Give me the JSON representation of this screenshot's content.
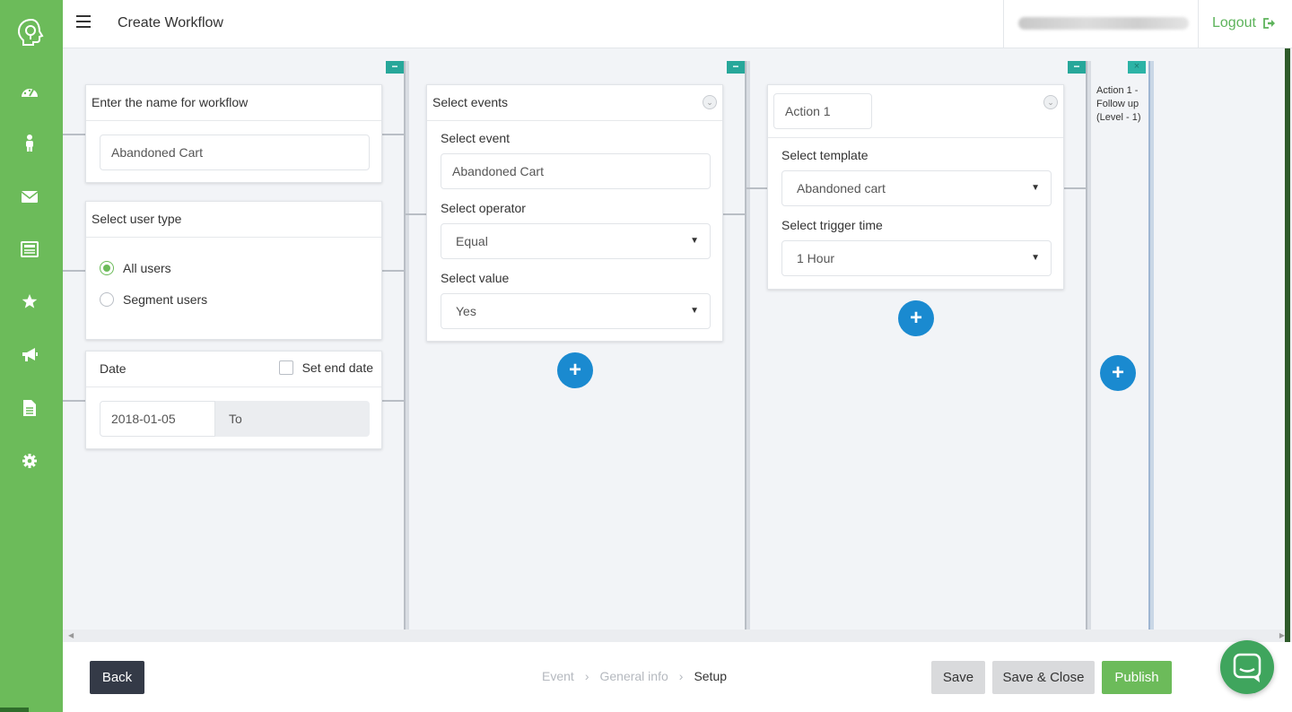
{
  "header": {
    "title": "Create Workflow",
    "logout_label": "Logout"
  },
  "sidebar": {
    "items": [
      {
        "icon": "dashboard-icon"
      },
      {
        "icon": "user-icon"
      },
      {
        "icon": "envelope-icon"
      },
      {
        "icon": "list-icon"
      },
      {
        "icon": "star-icon"
      },
      {
        "icon": "megaphone-icon"
      },
      {
        "icon": "document-icon"
      },
      {
        "icon": "gear-icon"
      }
    ]
  },
  "col1": {
    "name_card": {
      "title": "Enter the name for workflow",
      "name_value": "Abandoned Cart"
    },
    "user_type_card": {
      "title": "Select user type",
      "options": [
        "All users",
        "Segment users"
      ],
      "selected": "All users"
    },
    "date_card": {
      "title": "Date",
      "end_date_label": "Set end date",
      "start_date": "2018-01-05",
      "end_placeholder": "To"
    }
  },
  "col2": {
    "title": "Select events",
    "event_label": "Select event",
    "event_value": "Abandoned Cart",
    "operator_label": "Select operator",
    "operator_value": "Equal",
    "value_label": "Select value",
    "value_value": "Yes"
  },
  "col3": {
    "action_name": "Action 1",
    "template_label": "Select template",
    "template_value": "Abandoned cart",
    "trigger_label": "Select trigger time",
    "trigger_value": "1 Hour"
  },
  "col4": {
    "summary_line1": "Action 1 -",
    "summary_line2": "Follow up",
    "summary_line3": "(Level - 1)"
  },
  "footer": {
    "back_label": "Back",
    "steps": [
      "Event",
      "General info",
      "Setup"
    ],
    "active_step": "Setup",
    "save_label": "Save",
    "save_close_label": "Save & Close",
    "publish_label": "Publish"
  },
  "colors": {
    "brand_green": "#6cbb5a",
    "accent_blue": "#1a8ad0",
    "teal": "#27a79a",
    "dark": "#343a47"
  }
}
